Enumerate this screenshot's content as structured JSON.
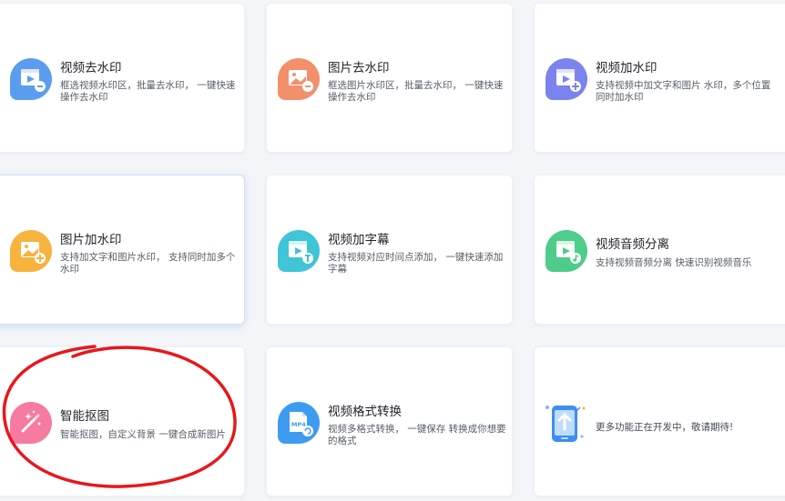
{
  "tools": [
    {
      "title": "视频去水印",
      "desc": "框选视频水印区，批量去水印， 一键快速操作去水印",
      "icon": "video-badge-icon",
      "color": "#5b9cf0"
    },
    {
      "title": "图片去水印",
      "desc": "框选图片水印区，批量去水印， 一键快速操作去水印",
      "icon": "image-badge-icon",
      "color": "#f2906c"
    },
    {
      "title": "视频加水印",
      "desc": "支持视频中加文字和图片 水印，多个位置同时加水印",
      "icon": "video-badge-icon",
      "color": "#7a83ee"
    },
    {
      "title": "图片加水印",
      "desc": "支持加文字和图片水印， 支持同时加多个水印",
      "icon": "image-badge-icon",
      "color": "#f7b33d"
    },
    {
      "title": "视频加字幕",
      "desc": "支持视频对应时间点添加， 一键快速添加字幕",
      "icon": "video-badge-icon",
      "color": "#3fc4d8"
    },
    {
      "title": "视频音频分离",
      "desc": "支持视频音频分离 快速识别视频音乐",
      "icon": "video-badge-icon",
      "color": "#4fcc8a"
    },
    {
      "title": "智能抠图",
      "desc": "智能抠图，自定义背景 一键合成新图片",
      "icon": "magic-wand-icon",
      "color": "#f77aa0"
    },
    {
      "title": "视频格式转换",
      "desc": "视频多格式转换， 一键保存 转换成你想要的格式",
      "icon": "mp4-file-icon",
      "color": "#3e9cf0",
      "badge": "MP4"
    }
  ],
  "coming_soon": {
    "text": "更多功能正在开发中，敬请期待!",
    "icon": "phone-upload-icon"
  },
  "annotation_color": "#e8171c"
}
